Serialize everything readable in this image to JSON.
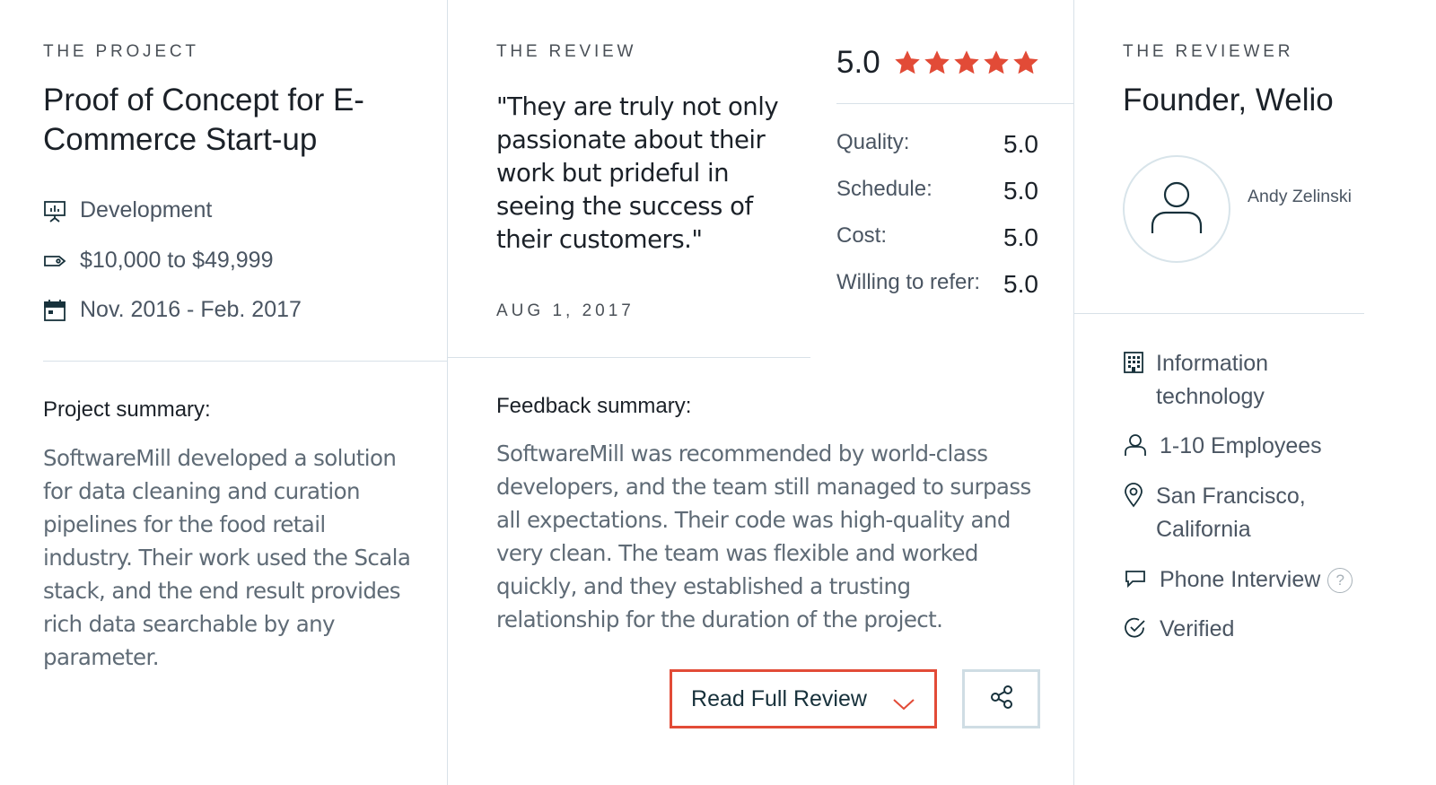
{
  "project": {
    "eyebrow": "THE PROJECT",
    "title": "Proof of Concept for E-Commerce Start-up",
    "meta": [
      {
        "icon": "presentation-board-icon",
        "text": "Development"
      },
      {
        "icon": "price-tag-icon",
        "text": "$10,000 to $49,999"
      },
      {
        "icon": "calendar-icon",
        "text": "Nov. 2016 - Feb. 2017"
      }
    ],
    "summary_heading": "Project summary:",
    "summary_text": "SoftwareMill developed a solution for data cleaning and curation pipelines for the food retail industry. Their work used the Scala stack, and the end result provides rich data searchable by any parameter."
  },
  "review": {
    "eyebrow": "THE REVIEW",
    "quote": "\"They are truly not only passionate about their work but prideful in seeing the success of their customers.\"",
    "date": "AUG 1, 2017",
    "overall_score": "5.0",
    "stars": 5,
    "ratings": [
      {
        "label": "Quality:",
        "value": "5.0"
      },
      {
        "label": "Schedule:",
        "value": "5.0"
      },
      {
        "label": "Cost:",
        "value": "5.0"
      },
      {
        "label": "Willing to refer:",
        "value": "5.0"
      }
    ],
    "feedback_heading": "Feedback summary:",
    "feedback_text": "SoftwareMill was recommended by world-class developers, and the team still managed to surpass all expectations. Their code was high-quality and very clean. The team was flexible and worked quickly, and they established a trusting relationship for the duration of the project.",
    "read_full_label": "Read Full Review"
  },
  "reviewer": {
    "eyebrow": "THE REVIEWER",
    "title": "Founder, Welio",
    "name": "Andy Zelinski",
    "info": [
      {
        "icon": "building-icon",
        "text": "Information technology"
      },
      {
        "icon": "person-icon",
        "text": "1-10 Employees"
      },
      {
        "icon": "location-pin-icon",
        "text": "San Francisco, California"
      },
      {
        "icon": "speech-bubble-icon",
        "text": "Phone Interview",
        "help": "?"
      },
      {
        "icon": "check-circle-icon",
        "text": "Verified"
      }
    ]
  },
  "colors": {
    "accent": "#e24b37",
    "divider": "#d8e1e8",
    "text_dark": "#1b2128",
    "text_muted": "#5f6b76",
    "icon": "#17313b"
  }
}
